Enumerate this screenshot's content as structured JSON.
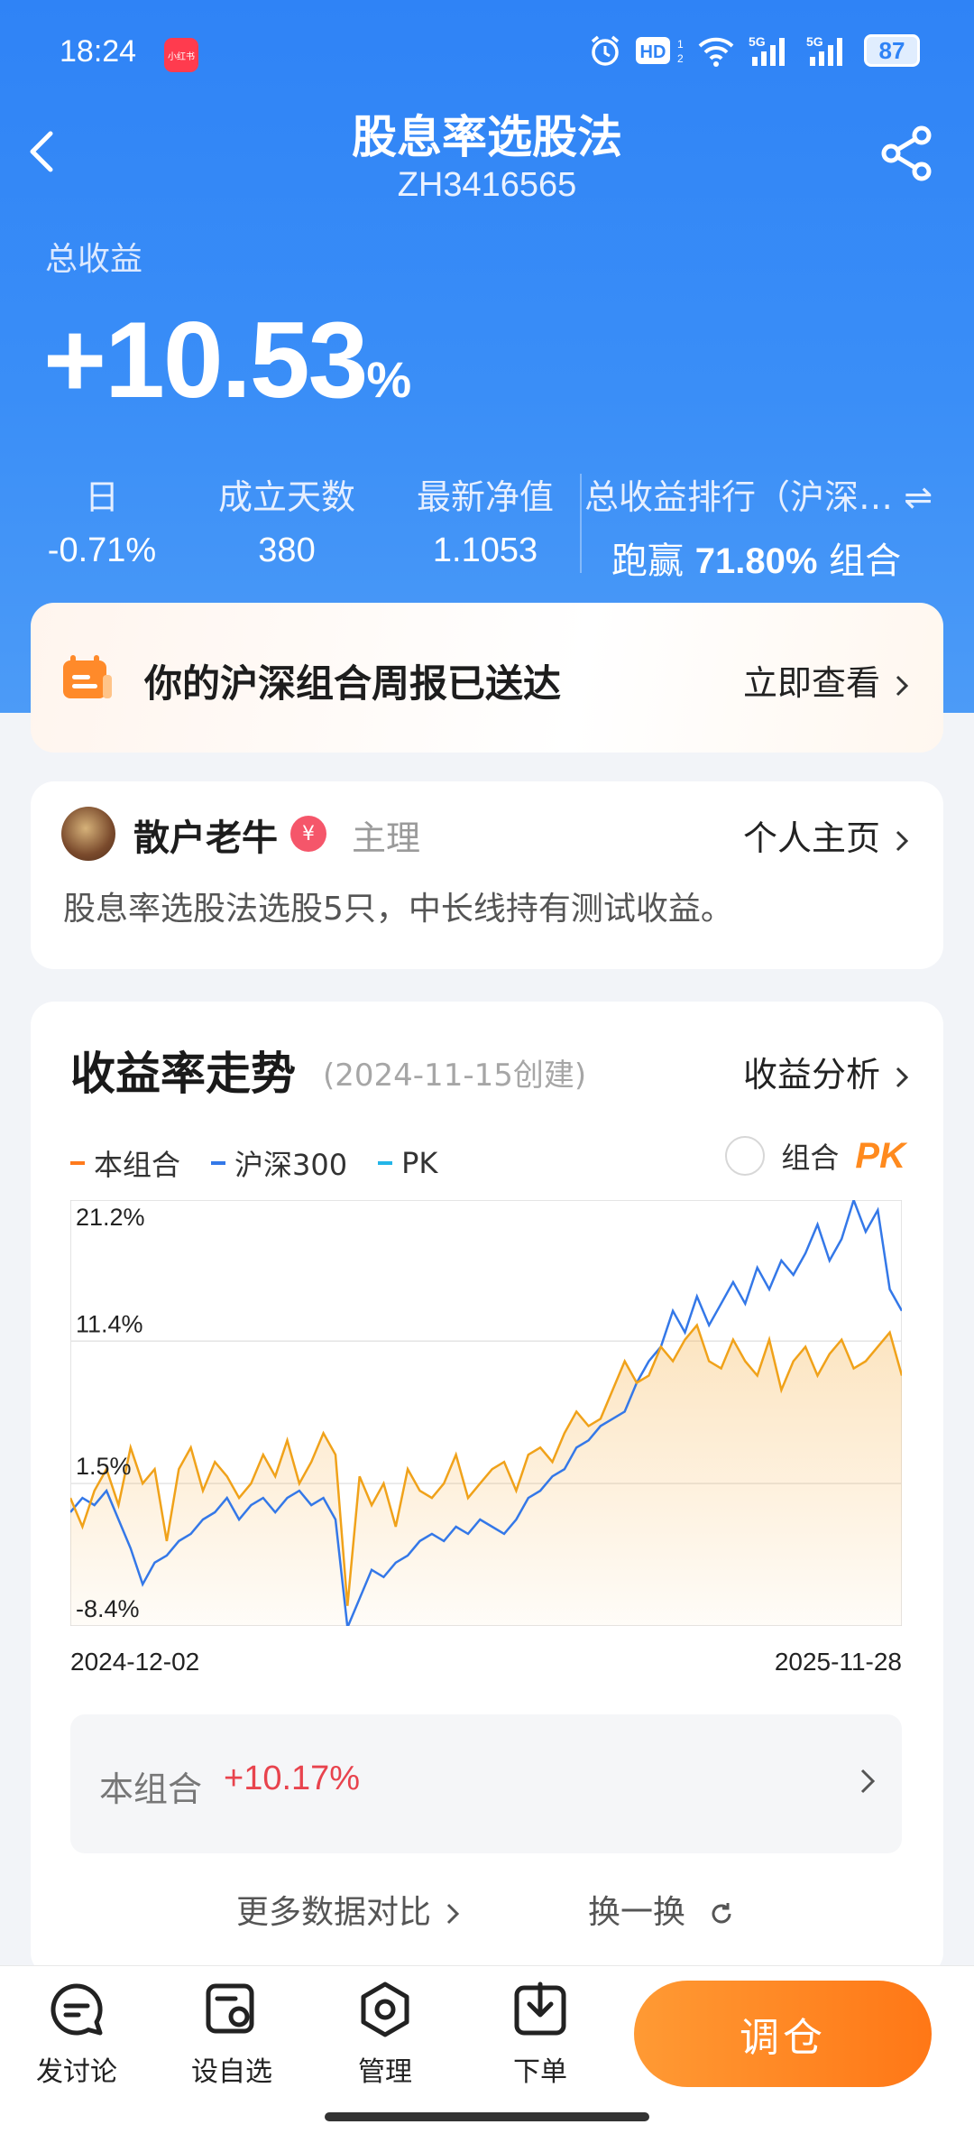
{
  "status_bar": {
    "time": "18:24",
    "app_badge": "小红书",
    "battery": "87"
  },
  "header": {
    "title": "股息率选股法",
    "code": "ZH3416565"
  },
  "summary_top": {
    "total_label": "总收益",
    "total_value": "+10.53",
    "total_unit": "%",
    "stats": [
      {
        "label": "日",
        "value": "-0.71%"
      },
      {
        "label": "成立天数",
        "value": "380"
      },
      {
        "label": "最新净值",
        "value": "1.1053"
      }
    ],
    "rank_label": "总收益排行（沪深…",
    "rank_prefix": "跑赢",
    "rank_value": "71.80%",
    "rank_suffix": "组合"
  },
  "notice": {
    "text": "你的沪深组合周报已送达",
    "link": "立即查看"
  },
  "author": {
    "name": "散户老牛",
    "badge": "¥",
    "role": "主理",
    "home_link": "个人主页",
    "description": "股息率选股法选股5只，中长线持有测试收益。"
  },
  "chart_section": {
    "title": "收益率走势",
    "created": "(2024-11-15创建)",
    "analysis_link": "收益分析",
    "pk_label": "组合",
    "pk_badge": "PK",
    "summary_label": "本组合",
    "summary_value": "+10.17%",
    "more_link": "更多数据对比",
    "swap_link": "换一换"
  },
  "chart_data": {
    "type": "line",
    "legend": [
      "本组合",
      "沪深300",
      "PK"
    ],
    "colors": {
      "portfolio": "#f0a21a",
      "hs300": "#3478e8",
      "pk": "#23b5e8"
    },
    "y_ticks": [
      "21.2%",
      "11.4%",
      "1.5%",
      "-8.4%"
    ],
    "ylim": [
      -8.4,
      21.2
    ],
    "x_labels": [
      "2024-12-02",
      "2025-11-28"
    ],
    "x_start": "2024-12-02",
    "x_end": "2025-11-28",
    "series": [
      {
        "name": "本组合",
        "values": [
          0.5,
          -1.5,
          1.0,
          2.5,
          0.0,
          4.0,
          1.5,
          2.5,
          -2.5,
          2.5,
          4.0,
          1.0,
          3.0,
          2.0,
          0.5,
          1.5,
          3.5,
          2.0,
          4.5,
          1.5,
          3.0,
          5.0,
          3.5,
          -7.0,
          2.0,
          0.0,
          1.5,
          -1.5,
          2.5,
          1.0,
          0.5,
          1.5,
          3.5,
          0.5,
          1.5,
          2.5,
          3.0,
          1.0,
          3.5,
          4.0,
          3.0,
          5.0,
          6.5,
          5.5,
          6.0,
          8.0,
          10.0,
          8.5,
          9.0,
          11.0,
          10.0,
          11.5,
          12.5,
          10.0,
          9.5,
          11.5,
          10.0,
          9.0,
          11.5,
          8.0,
          10.0,
          11.0,
          9.0,
          10.5,
          11.5,
          9.5,
          10.0,
          11.0,
          12.0,
          9.0
        ]
      },
      {
        "name": "沪深300",
        "values": [
          -0.5,
          0.5,
          0.0,
          1.0,
          -1.0,
          -3.0,
          -5.5,
          -4.0,
          -3.5,
          -2.5,
          -2.0,
          -1.0,
          -0.5,
          0.5,
          -1.0,
          0.0,
          0.5,
          -0.5,
          0.5,
          1.0,
          0.0,
          0.5,
          -1.0,
          -8.5,
          -6.5,
          -4.5,
          -5.0,
          -4.0,
          -3.5,
          -2.5,
          -2.0,
          -2.5,
          -1.5,
          -2.0,
          -1.0,
          -1.5,
          -2.0,
          -1.0,
          0.5,
          1.0,
          2.0,
          2.5,
          4.0,
          4.5,
          5.5,
          6.0,
          6.5,
          8.5,
          10.0,
          11.0,
          13.5,
          12.0,
          14.5,
          12.5,
          14.0,
          15.5,
          14.0,
          16.5,
          15.0,
          17.0,
          16.0,
          17.5,
          19.5,
          17.0,
          18.5,
          21.2,
          19.0,
          20.5,
          15.0,
          13.5
        ]
      }
    ]
  },
  "tabbar": {
    "items": [
      {
        "label": "发讨论",
        "icon": "discussion-icon"
      },
      {
        "label": "设自选",
        "icon": "watchlist-icon"
      },
      {
        "label": "管理",
        "icon": "settings-icon"
      },
      {
        "label": "下单",
        "icon": "order-icon"
      }
    ],
    "cta": "调仓"
  }
}
